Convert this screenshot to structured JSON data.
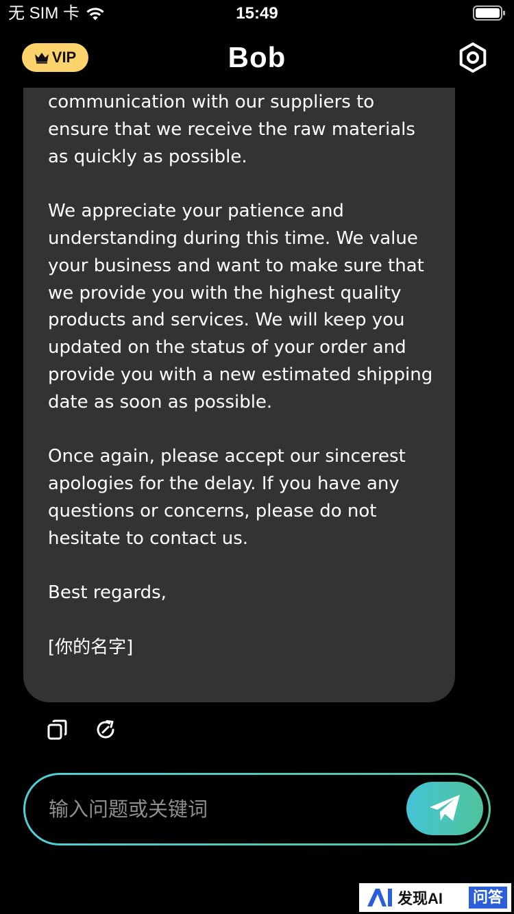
{
  "status_bar": {
    "carrier": "无 SIM 卡",
    "time": "15:49",
    "icons": [
      "wifi-icon",
      "battery-icon"
    ]
  },
  "nav": {
    "vip_label": "VIP",
    "title": "Bob",
    "icons": [
      "crown-icon",
      "settings-icon"
    ]
  },
  "message": {
    "paragraphs": [
      "communication with our suppliers to ensure that we receive the raw materials as quickly as possible.",
      "We appreciate your patience and understanding during this time. We value your business and want to make sure that we provide you with the highest quality products and services. We will keep you updated on the status of your order and provide you with a new estimated shipping date as soon as possible.",
      "Once again, please accept our sincerest apologies for the delay. If you have any questions or concerns, please do not hesitate to contact us.",
      "Best regards,",
      "[你的名字]"
    ],
    "actions": [
      "copy-icon",
      "refresh-icon"
    ]
  },
  "input": {
    "placeholder": "输入问题或关键词",
    "send_icon": "send-icon"
  },
  "watermark": {
    "brand": "发现AI",
    "badge": "问答"
  },
  "colors": {
    "background": "#000000",
    "bubble": "#323333",
    "vip_badge": "#ffd36b",
    "accent_start": "#45c3d6",
    "accent_end": "#4fc49a",
    "placeholder": "#8e8e8e"
  }
}
